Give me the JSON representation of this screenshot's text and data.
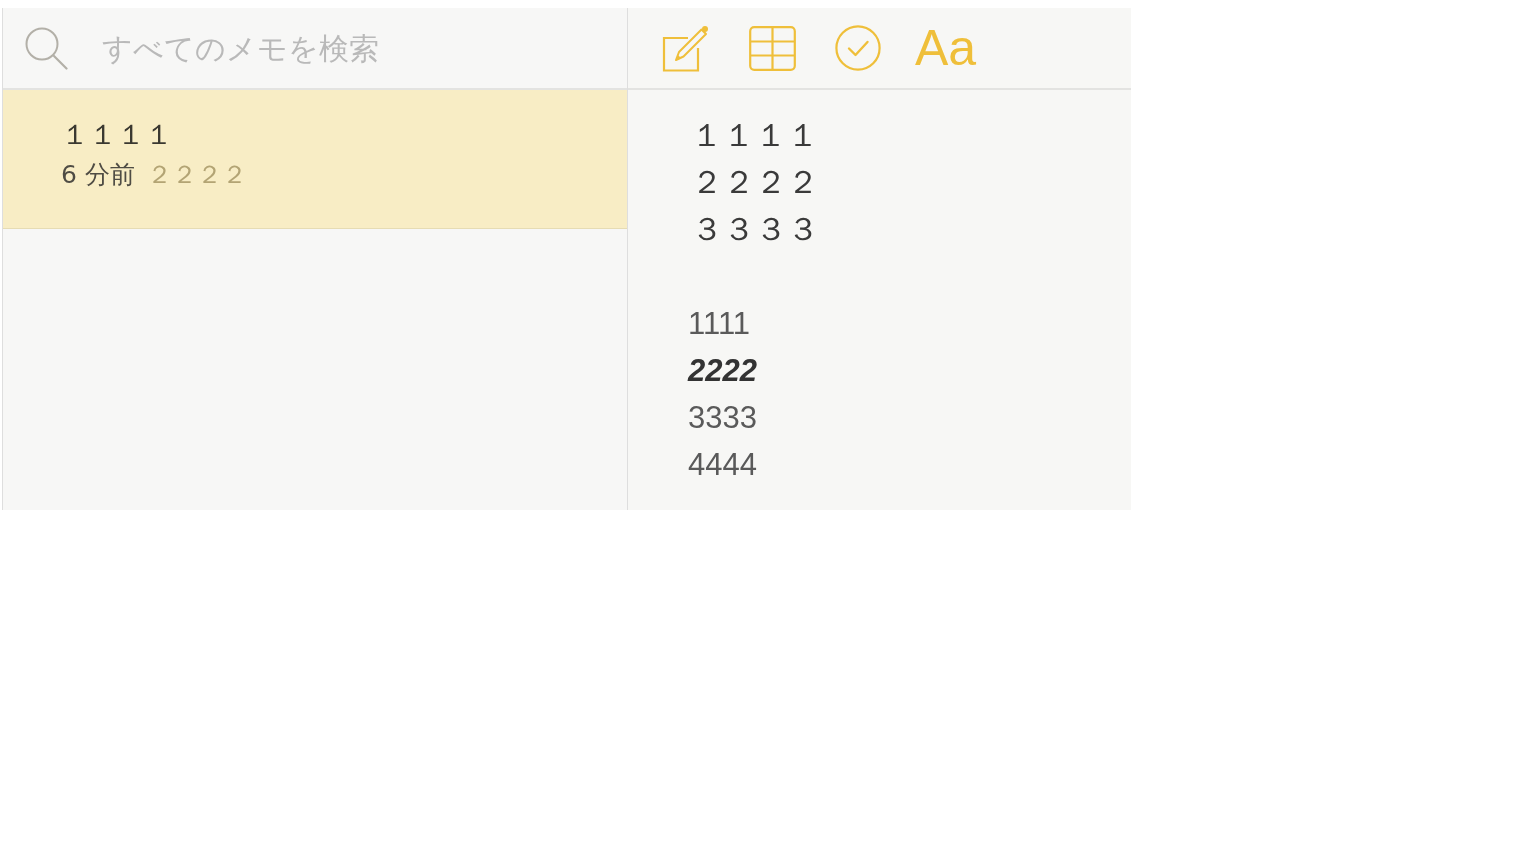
{
  "search": {
    "placeholder": "すべてのメモを検索"
  },
  "toolbar": {
    "format_label": "Aa"
  },
  "notes": [
    {
      "title": "１１１１",
      "time": "6 分前",
      "preview": "２２２２",
      "selected": true
    }
  ],
  "editor": {
    "paragraphs": [
      {
        "kind": "wide",
        "lines": [
          {
            "text": "１１１１",
            "kind": "regular"
          },
          {
            "text": "２２２２",
            "kind": "regular"
          },
          {
            "text": "３３３３",
            "kind": "regular"
          }
        ]
      },
      {
        "kind": "plain",
        "lines": [
          {
            "text": "1111",
            "kind": "regular"
          },
          {
            "text": "2222",
            "kind": "italic"
          },
          {
            "text": "3333",
            "kind": "regular"
          },
          {
            "text": "4444",
            "kind": "regular"
          }
        ]
      }
    ]
  }
}
